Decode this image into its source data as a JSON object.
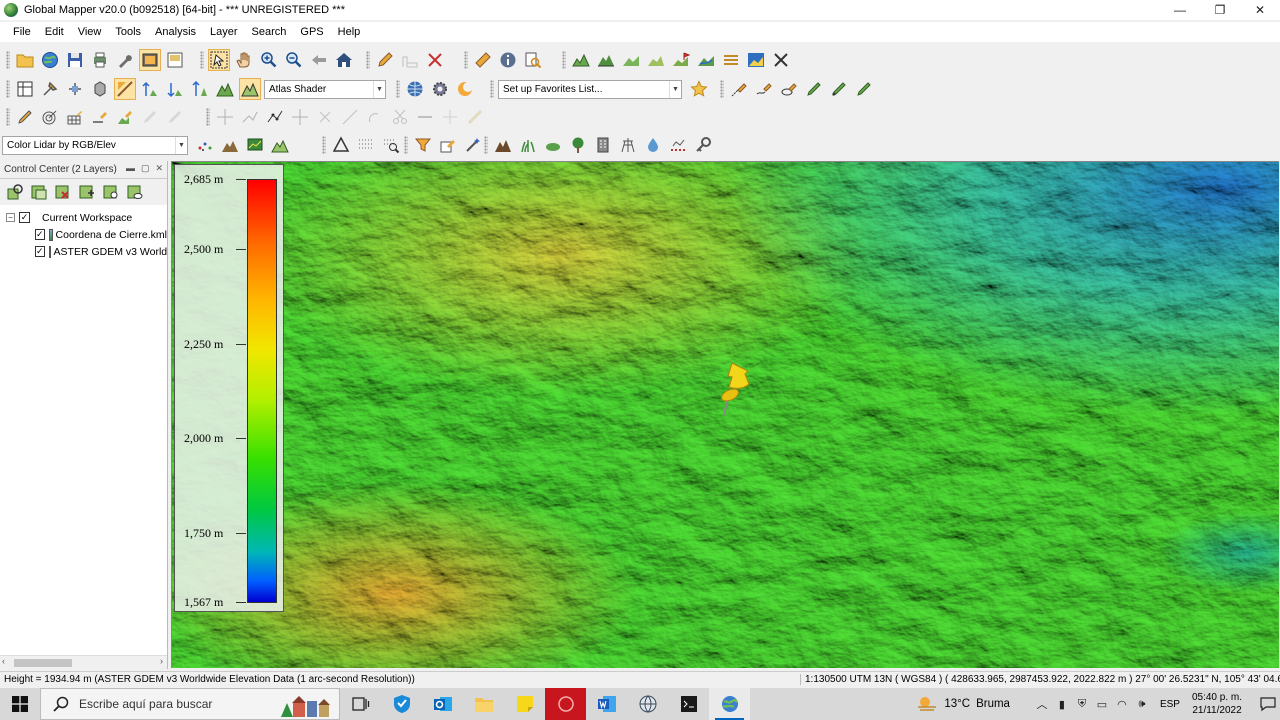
{
  "window": {
    "title": "Global Mapper v20.0 (b092518) [64-bit] - *** UNREGISTERED ***",
    "minimize": "—",
    "maximize": "❐",
    "close": "✕"
  },
  "menu": [
    "File",
    "Edit",
    "View",
    "Tools",
    "Analysis",
    "Layer",
    "Search",
    "GPS",
    "Help"
  ],
  "toolbars": {
    "shader_select": "Atlas Shader",
    "favorites_select": "Set up Favorites List...",
    "lidar_select": "Color Lidar by RGB/Elev"
  },
  "control_center": {
    "title": "Control Center (2 Layers)",
    "workspace": "Current Workspace",
    "layers": [
      {
        "name": "Coordena de Cierre.kml",
        "checked": true
      },
      {
        "name": "ASTER GDEM v3 Worldwide Elevation Data (1 arc-second Resolution)",
        "checked": true
      }
    ]
  },
  "legend": {
    "labels": [
      "2,685 m",
      "2,500 m",
      "2,250 m",
      "2,000 m",
      "1,750 m",
      "1,567 m"
    ],
    "max": 2685,
    "min": 1567
  },
  "status": {
    "left": "Height = 1934.94 m (ASTER GDEM v3 Worldwide Elevation Data (1 arc-second Resolution))",
    "right": "1:130500  UTM 13N ( WGS84 ) ( 428633.965, 2987453.922, 2022.822 m )  27° 00' 26.5231\" N, 105° 43' 04.6154\" W"
  },
  "taskbar": {
    "search_placeholder": "Escribe aquí para buscar",
    "weather_temp": "13°C",
    "weather_desc": "Bruma",
    "language": "ESP",
    "time": "05:40 p. m.",
    "date": "21/11/2022"
  },
  "colors": {
    "toolbar_bg": "#f0f0f0",
    "active_tool": "#fde3a3",
    "taskbar_bg": "#d8d8d8",
    "accent": "#0067c0"
  }
}
